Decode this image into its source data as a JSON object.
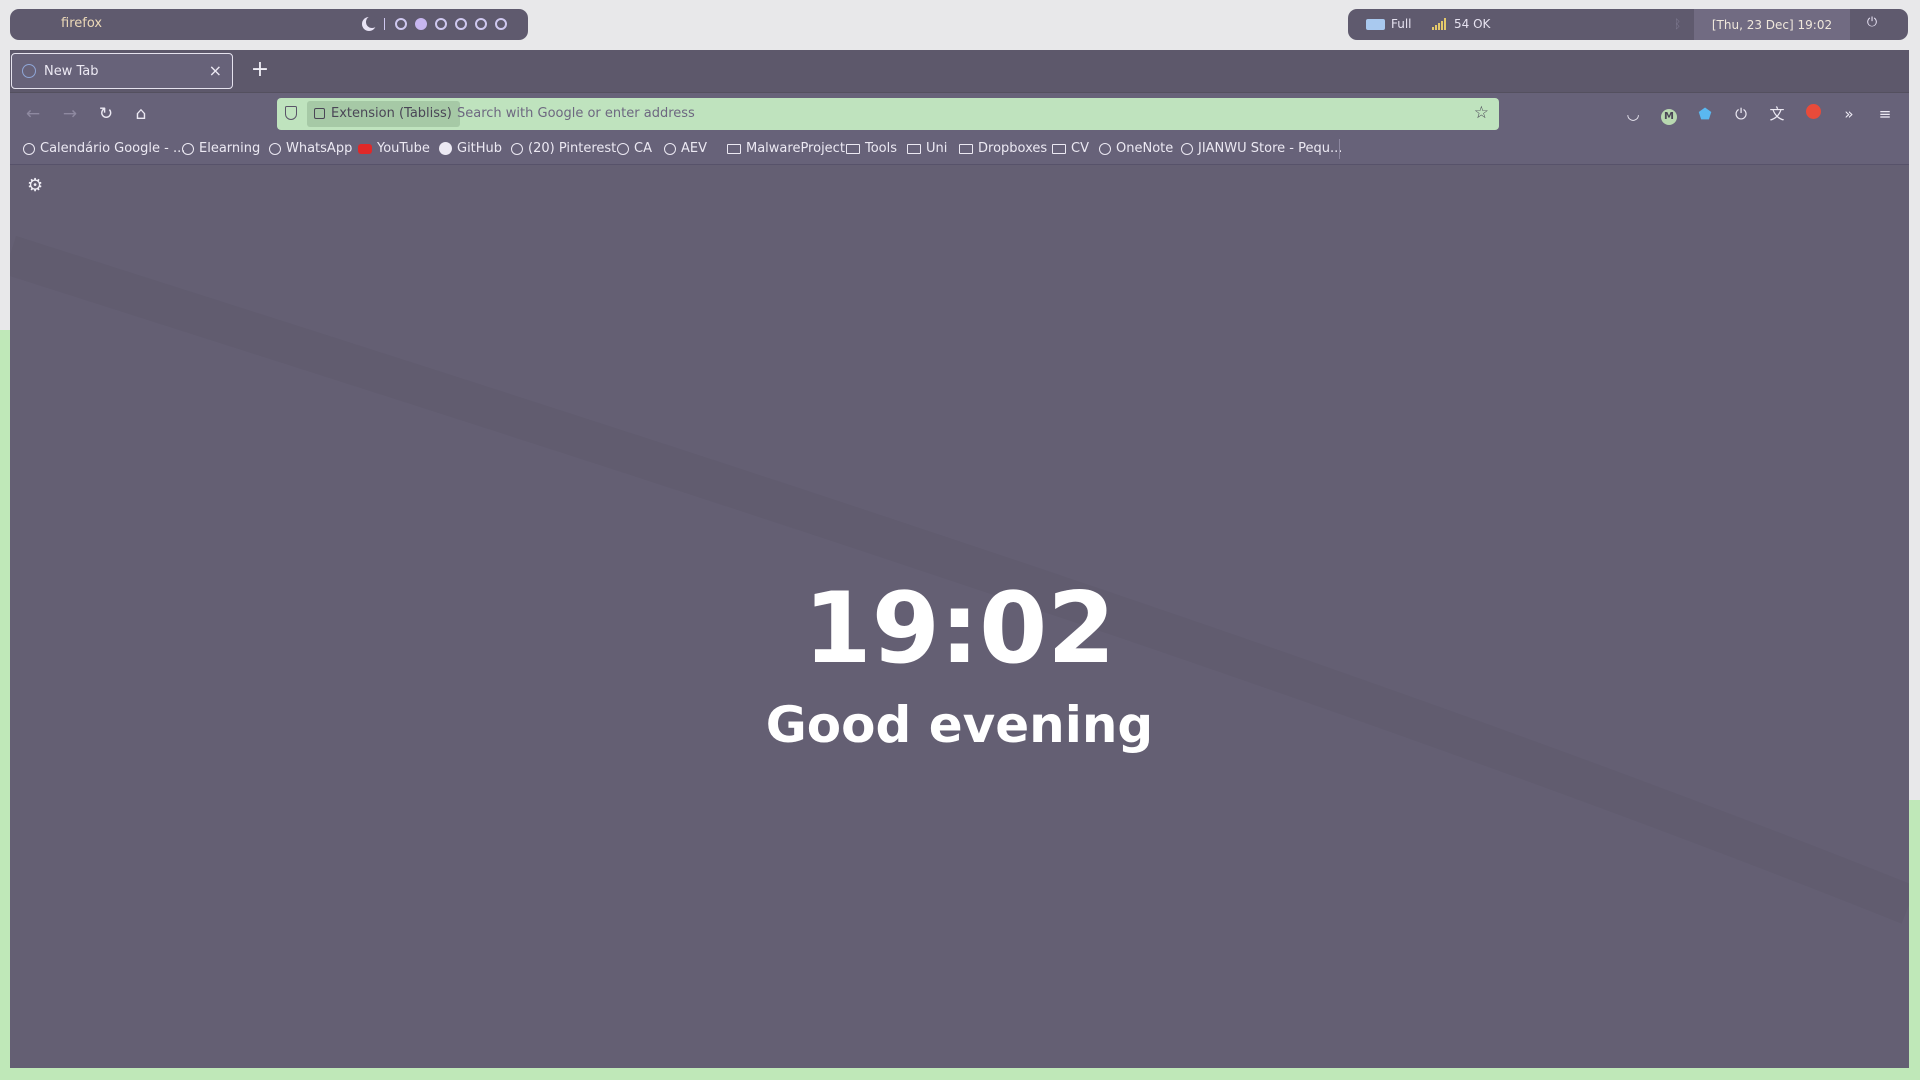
{
  "wm": {
    "app_title": "firefox",
    "workspaces": [
      {
        "name": "1",
        "active": false
      },
      {
        "name": "2",
        "active": true
      },
      {
        "name": "3",
        "active": false
      },
      {
        "name": "4",
        "active": false
      },
      {
        "name": "5",
        "active": false
      },
      {
        "name": "6",
        "active": false
      }
    ],
    "battery": "Full",
    "network": "54 OK",
    "datetime": "[Thu, 23 Dec] 19:02"
  },
  "tabs": [
    {
      "label": "New Tab"
    }
  ],
  "url": {
    "extension_label": "Extension (Tabliss)",
    "placeholder": "Search with Google or enter address"
  },
  "bookmarks": [
    {
      "label": "Calendário Google - ...",
      "icon": "globe-icon"
    },
    {
      "label": "Elearning",
      "icon": "globe-icon"
    },
    {
      "label": "WhatsApp",
      "icon": "globe-icon"
    },
    {
      "label": "YouTube",
      "icon": "youtube-icon"
    },
    {
      "label": "GitHub",
      "icon": "github-icon"
    },
    {
      "label": "(20) Pinterest",
      "icon": "globe-icon"
    },
    {
      "label": "CA",
      "icon": "globe-icon"
    },
    {
      "label": "AEV",
      "icon": "globe-icon"
    },
    {
      "label": "MalwareProject",
      "icon": "folder-icon"
    },
    {
      "label": "Tools",
      "icon": "folder-icon"
    },
    {
      "label": "Uni",
      "icon": "folder-icon"
    },
    {
      "label": "Dropboxes",
      "icon": "folder-icon"
    },
    {
      "label": "CV",
      "icon": "folder-icon"
    },
    {
      "label": "OneNote",
      "icon": "globe-icon"
    },
    {
      "label": "JIANWU Store - Pequ...",
      "icon": "globe-icon"
    }
  ],
  "newtab": {
    "time": "19:02",
    "greeting": "Good evening"
  },
  "colors": {
    "accent": "#bfe3be",
    "background": "#645f73"
  }
}
